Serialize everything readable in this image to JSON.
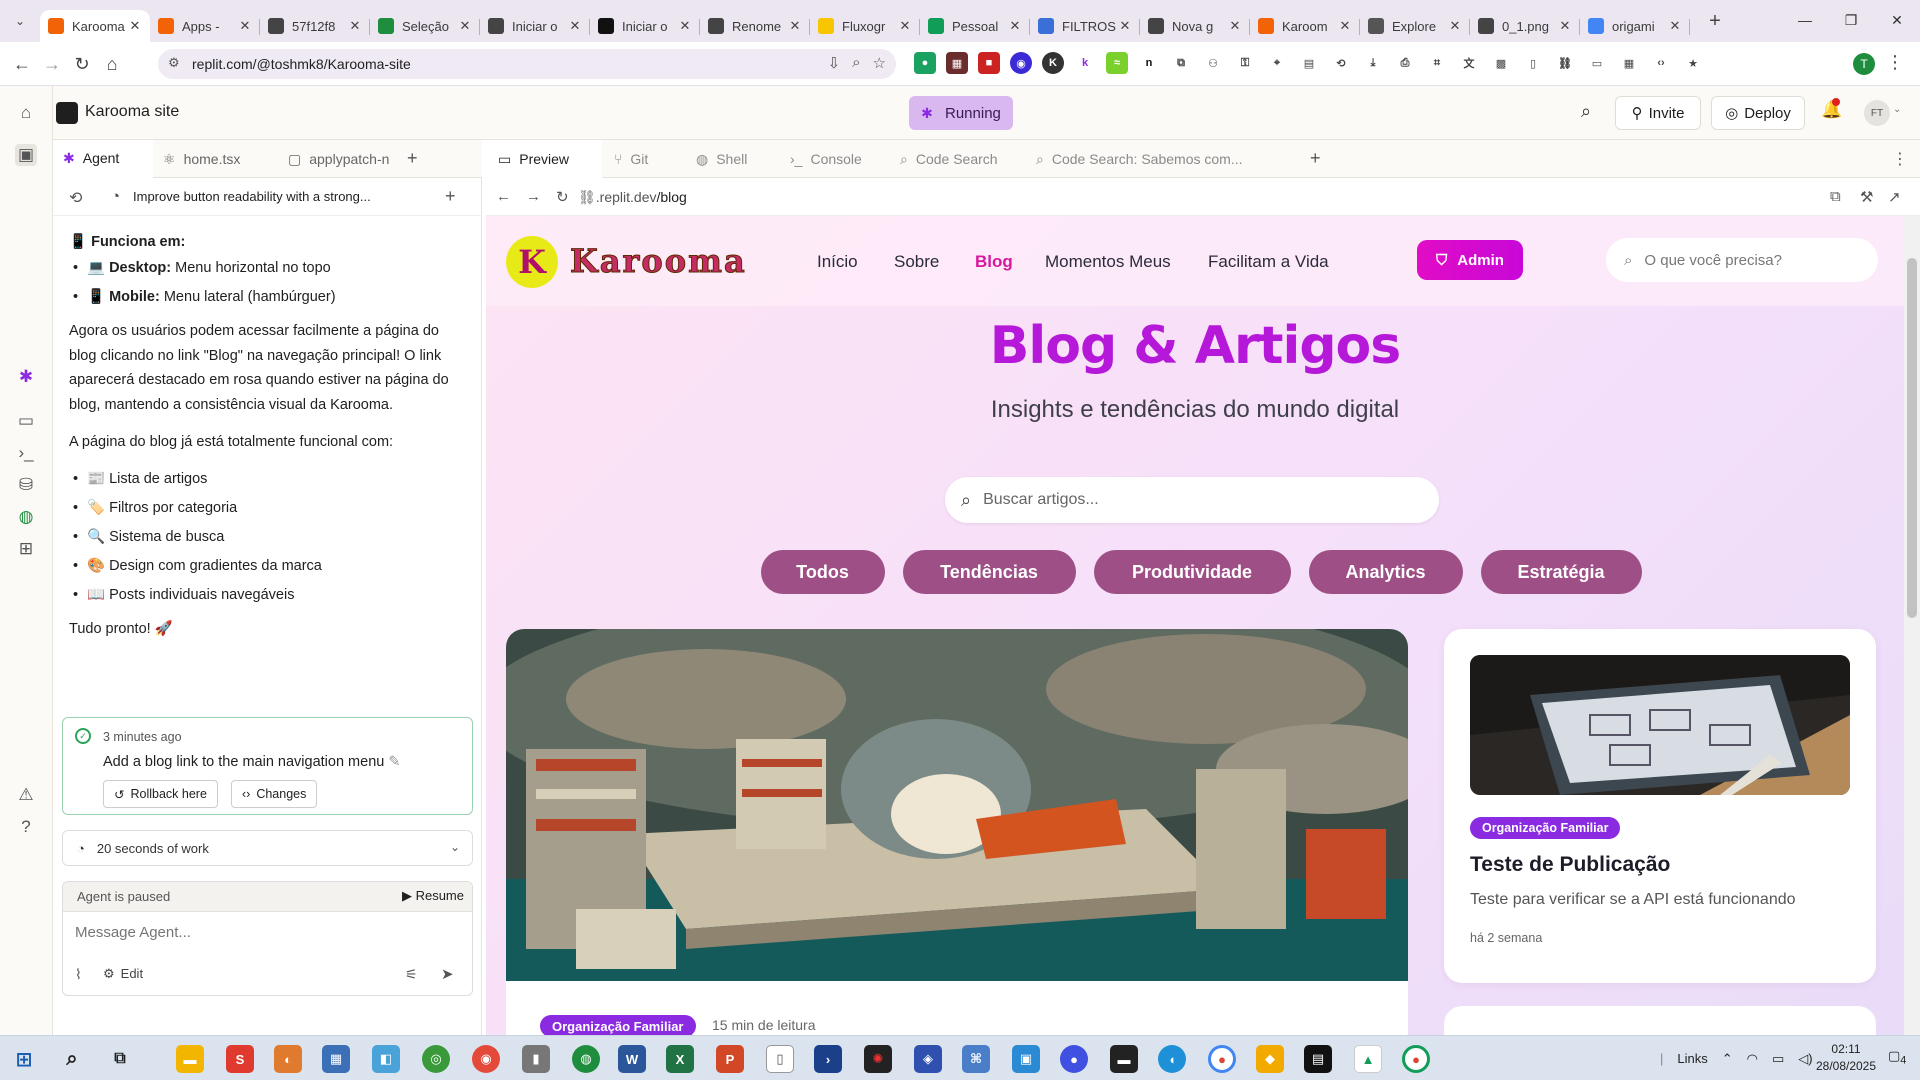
{
  "browser": {
    "tabs": [
      {
        "label": "Karooma",
        "active": true,
        "favicon_color": "#f26207"
      },
      {
        "label": "Apps - ",
        "favicon_color": "#f26207"
      },
      {
        "label": "57f12f8",
        "favicon_color": "#444444"
      },
      {
        "label": "Seleção",
        "favicon_color": "#1e8e3e"
      },
      {
        "label": "Iniciar o",
        "favicon_color": "#444444"
      },
      {
        "label": "Iniciar o",
        "favicon_color": "#111111"
      },
      {
        "label": "Renome",
        "favicon_color": "#444444"
      },
      {
        "label": "Fluxogr",
        "favicon_color": "#f7c600"
      },
      {
        "label": "Pessoal",
        "favicon_color": "#0f9d58"
      },
      {
        "label": "FILTROS",
        "favicon_color": "#3a6fd8"
      },
      {
        "label": "Nova g",
        "favicon_color": "#444444"
      },
      {
        "label": "Karoom",
        "favicon_color": "#f26207"
      },
      {
        "label": "Explore",
        "favicon_color": "#555555"
      },
      {
        "label": "0_1.png",
        "favicon_color": "#444444"
      },
      {
        "label": "origami",
        "favicon_color": "#4285f4"
      }
    ],
    "url": "replit.com/@toshmk8/Karooma-site",
    "profile_initial": "T"
  },
  "replit": {
    "project_name": "Karooma site",
    "run_status": "Running",
    "invite_label": "Invite",
    "deploy_label": "Deploy",
    "avatar_initials": "FT",
    "left_tabs": [
      "Agent",
      "home.tsx",
      "applypatch-n"
    ],
    "chat_title": "Improve button readability with a strong...",
    "chat": {
      "works_on_heading": "📱 Funciona em:",
      "works_on": [
        {
          "bold": "💻 Desktop:",
          "text": " Menu horizontal no topo"
        },
        {
          "bold": "📱 Mobile:",
          "text": " Menu lateral (hambúrguer)"
        }
      ],
      "para1": "Agora os usuários podem acessar facilmente a página do blog clicando no link \"Blog\" na navegação principal! O link aparecerá destacado em rosa quando estiver na página do blog, mantendo a consistência visual da Karooma.",
      "para2": "A página do blog já está totalmente funcional com:",
      "features": [
        "📰 Lista de artigos",
        "🏷️ Filtros por categoria",
        "🔍 Sistema de busca",
        "🎨 Design com gradientes da marca",
        "📖 Posts individuais navegáveis"
      ],
      "done": "Tudo pronto! 🚀"
    },
    "checkpoint": {
      "time": "3 minutes ago",
      "message": "Add a blog link to the main navigation menu",
      "rollback_label": "Rollback here",
      "changes_label": "Changes"
    },
    "work_summary": "20 seconds of work",
    "agent_status": "Agent is paused",
    "resume_label": "Resume",
    "message_placeholder": "Message Agent...",
    "edit_label": "Edit",
    "right_tabs": [
      "Preview",
      "Git",
      "Shell",
      "Console",
      "Code Search",
      "Code Search: Sabemos com..."
    ],
    "preview_url_prefix": ".replit.dev",
    "preview_url_path": "/blog"
  },
  "site": {
    "logo_text": "Karooma",
    "nav": [
      "Início",
      "Sobre",
      "Blog",
      "Momentos Meus",
      "Facilitam a Vida"
    ],
    "active_nav": "Blog",
    "admin_label": "Admin",
    "search_placeholder": "O que você precisa?",
    "hero_title": "Blog & Artigos",
    "hero_subtitle": "Insights e tendências do mundo digital",
    "blog_search_placeholder": "Buscar artigos...",
    "categories": [
      "Todos",
      "Tendências",
      "Produtividade",
      "Analytics",
      "Estratégia"
    ],
    "featured": {
      "badge": "Organização Familiar",
      "read_time": "15 min de leitura"
    },
    "card": {
      "badge": "Organização Familiar",
      "title": "Teste de Publicação",
      "description": "Teste para verificar se a API está funcionando",
      "date": "há 2 semana"
    },
    "colors": {
      "brand_pink": "#d6189e",
      "hero_purple": "#b518d8",
      "category_bg": "#9e4f85",
      "badge_bg": "#8a2be2"
    }
  },
  "taskbar": {
    "links_label": "Links",
    "time": "02:11",
    "date": "28/08/2025",
    "notifications": "4"
  }
}
